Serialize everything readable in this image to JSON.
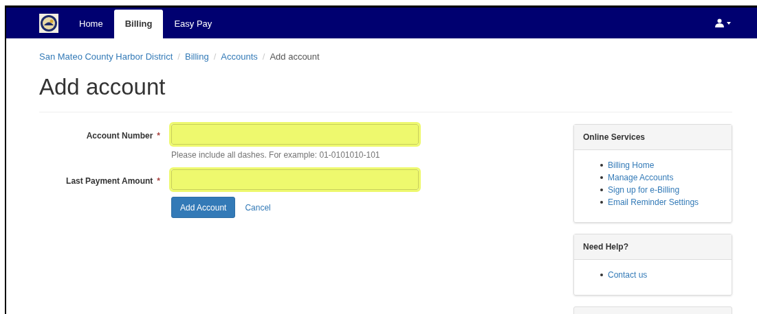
{
  "navbar": {
    "tabs": [
      {
        "label": "Home",
        "selected": false
      },
      {
        "label": "Billing",
        "selected": true
      },
      {
        "label": "Easy Pay",
        "selected": false
      }
    ]
  },
  "breadcrumb": {
    "links": [
      "San Mateo County Harbor District",
      "Billing",
      "Accounts"
    ],
    "separator": "/",
    "current": "Add account"
  },
  "title": "Add account",
  "form": {
    "fields": [
      {
        "label": "Account Number",
        "required_mark": "*",
        "highlighted": true,
        "help": "Please include all dashes. For example: 01-0101010-101"
      },
      {
        "label": "Last Payment Amount",
        "required_mark": "*",
        "highlighted": true
      }
    ],
    "submit": "Add Account",
    "cancel": "Cancel"
  },
  "panels": [
    {
      "title": "Online Services",
      "links": [
        "Billing Home",
        "Manage Accounts",
        "Sign up for e-Billing",
        "Email Reminder Settings"
      ]
    },
    {
      "title": "Need Help?",
      "links": [
        "Contact us"
      ]
    }
  ]
}
